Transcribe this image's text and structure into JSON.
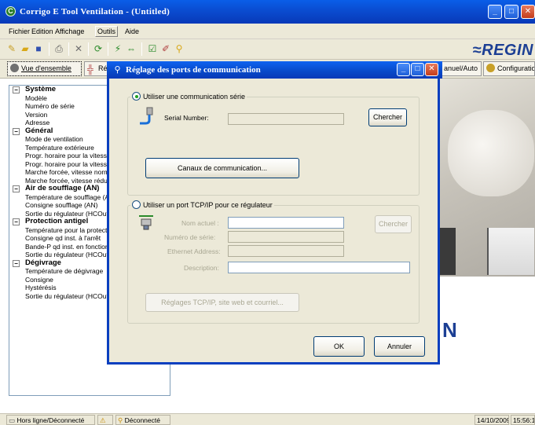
{
  "window": {
    "title": "Corrigo E Tool Ventilation - (Untitled)"
  },
  "menu": [
    "Fichier",
    "Edition",
    "Affichage",
    "Outils",
    "Aide"
  ],
  "logo": "≈REGIN",
  "tabs": {
    "overview": "Vue d'ensemble",
    "second": "Ré",
    "manual": "anuel/Auto",
    "config": "Configuratio"
  },
  "tree": [
    {
      "label": "Système",
      "group": true
    },
    {
      "label": "Modèle"
    },
    {
      "label": "Numéro de série"
    },
    {
      "label": "Version"
    },
    {
      "label": "Adresse"
    },
    {
      "label": "Général",
      "group": true
    },
    {
      "label": "Mode de ventilation"
    },
    {
      "label": "Température extérieure"
    },
    {
      "label": "Progr. horaire pour la vitesse"
    },
    {
      "label": "Progr. horaire pour la vitesse"
    },
    {
      "label": "Marche forcée, vitesse norm"
    },
    {
      "label": "Marche forcée, vitesse rédui"
    },
    {
      "label": "Air de soufflage (AN)",
      "group": true
    },
    {
      "label": "Température de soufflage (A"
    },
    {
      "label": "Consigne soufflage (AN)"
    },
    {
      "label": "Sortie du régulateur (HCOut)"
    },
    {
      "label": "Protection antigel",
      "group": true
    },
    {
      "label": "Température pour la protecti"
    },
    {
      "label": "Consigne qd inst. à l'arrêt"
    },
    {
      "label": "Bande-P qd inst. en fonction"
    },
    {
      "label": "Sortie du régulateur (HCOut)"
    },
    {
      "label": "Dégivrage",
      "group": true
    },
    {
      "label": "Température de dégivrage"
    },
    {
      "label": "Consigne"
    },
    {
      "label": "Hystérésis"
    },
    {
      "label": "Sortie du régulateur (HCOut)"
    }
  ],
  "background_text": "N",
  "dialog": {
    "title": "Réglage des ports de communication",
    "serial": {
      "radio_label": "Utiliser une communication série",
      "selected": true,
      "serial_number_label": "Serial Number:",
      "serial_number_value": "",
      "search_button": "Chercher",
      "channels_button": "Canaux de communication..."
    },
    "tcpip": {
      "radio_label": "Utiliser un port TCP/IP pour ce régulateur",
      "selected": false,
      "current_name_label": "Nom actuel :",
      "current_name_value": "",
      "serial_label": "Numéro de série:",
      "serial_value": "",
      "ethernet_label": "Ethernet Address:",
      "ethernet_value": "",
      "description_label": "Description:",
      "description_value": "",
      "search_button": "Chercher",
      "settings_button": "Réglages TCP/IP, site web et courriel..."
    },
    "ok_button": "OK",
    "cancel_button": "Annuler"
  },
  "status": {
    "connection": "Hors ligne/Déconnecté",
    "disconnected": "Déconnecté",
    "datetime_date": "14/10/2009",
    "datetime_time": "15:56:1"
  },
  "colors": {
    "titlebar": "#0a4cd0",
    "face": "#ece9d8",
    "brand": "#1c3f94"
  }
}
